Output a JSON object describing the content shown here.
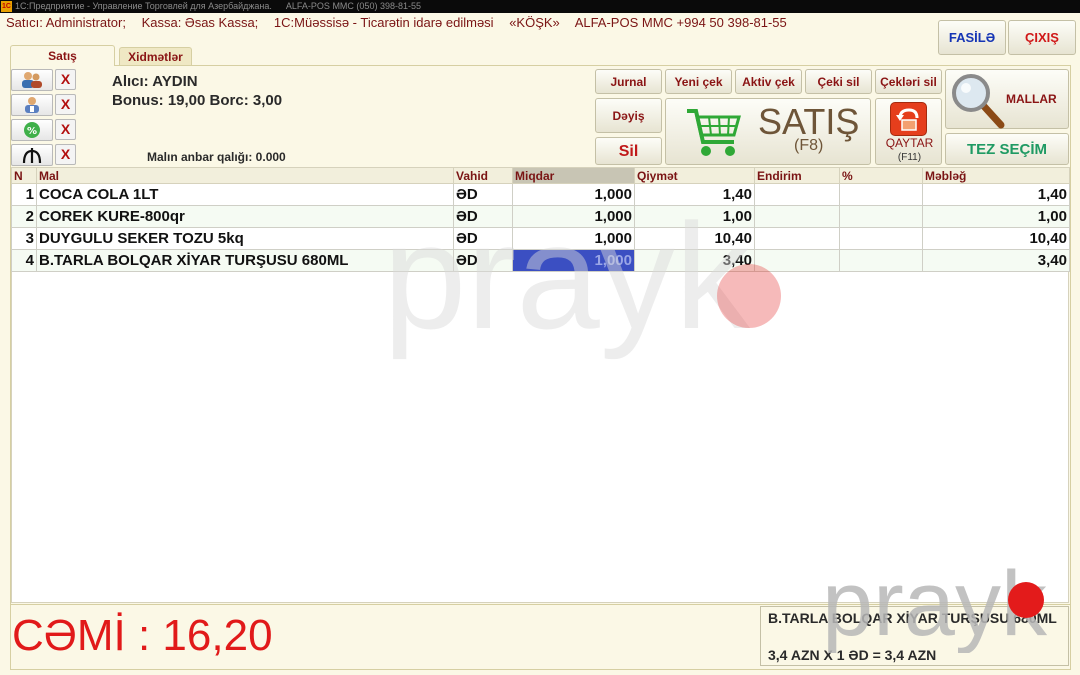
{
  "titlebar": {
    "app_icon": "1C",
    "title": "1С:Предприятие - Управление Торговлей для Азербайджана.",
    "subtitle": "ALFA-POS MMC (050) 398-81-55"
  },
  "infobar": {
    "seller": "Satıcı: Administrator;",
    "register": "Kassa: Əsas Kassa;",
    "company": "1C:Müəssisə - Ticarətin idarə edilməsi",
    "kiosk": "«KÖŞK»",
    "vendor": "ALFA-POS MMC +994 50 398-81-55"
  },
  "header_buttons": {
    "pause": "FASİLƏ",
    "exit": "ÇIXIŞ"
  },
  "tabs": [
    {
      "label": "Satış"
    },
    {
      "label": "Xidmətlər"
    }
  ],
  "customer": {
    "buyer": "Alıcı: AYDIN",
    "bonus_debt": "Bonus: 19,00 Borc: 3,00",
    "stock_left": "Malın anbar qalığı: 0.000"
  },
  "side_icons": [
    "customers-icon",
    "employee-icon",
    "discount-icon",
    "manat-icon"
  ],
  "side_clear_label": "X",
  "toolbar": {
    "journal": "Jurnal",
    "new_receipt": "Yeni çek",
    "active_receipt": "Aktiv çek",
    "delete_receipt": "Çeki sil",
    "delete_receipts": "Çekləri sil",
    "change": "Dəyiş",
    "delete": "Sil",
    "sale": "SATIŞ",
    "sale_key": "(F8)",
    "return": "QAYTAR",
    "return_key": "(F11)",
    "goods": "MALLAR",
    "quick_select": "TEZ SEÇİM"
  },
  "table": {
    "headers": [
      "N",
      "Mal",
      "Vahid",
      "Miqdar",
      "Qiymət",
      "Endirim",
      "%",
      "Məbləğ"
    ],
    "rows": [
      {
        "n": "1",
        "item": "COCA COLA 1LT",
        "unit": "ƏD",
        "qty": "1,000",
        "price": "1,40",
        "discount": "",
        "pct": "",
        "amount": "1,40"
      },
      {
        "n": "2",
        "item": "COREK KURE-800qr",
        "unit": "ƏD",
        "qty": "1,000",
        "price": "1,00",
        "discount": "",
        "pct": "",
        "amount": "1,00"
      },
      {
        "n": "3",
        "item": "DUYGULU SEKER TOZU 5kq",
        "unit": "ƏD",
        "qty": "1,000",
        "price": "10,40",
        "discount": "",
        "pct": "",
        "amount": "10,40"
      },
      {
        "n": "4",
        "item": "B.TARLA BOLQAR XİYAR TURŞUSU 680ML",
        "unit": "ƏD",
        "qty": "1,000",
        "price": "3,40",
        "discount": "",
        "pct": "",
        "amount": "3,40"
      }
    ]
  },
  "total": {
    "label": "CƏMİ : 16,20"
  },
  "last_item": {
    "name": "B.TARLA BOLQAR XİYAR TURŞUSU 680ML",
    "calc": "3,4 AZN  X  1 ƏD = 3,4 AZN"
  },
  "watermark": {
    "text": "prayk",
    "dot_color": "#e31b1b"
  },
  "colors": {
    "accent_red": "#e11a1a",
    "dark_red": "#8a1414",
    "green": "#1f9a63",
    "selection_blue": "#3b4fc2"
  }
}
